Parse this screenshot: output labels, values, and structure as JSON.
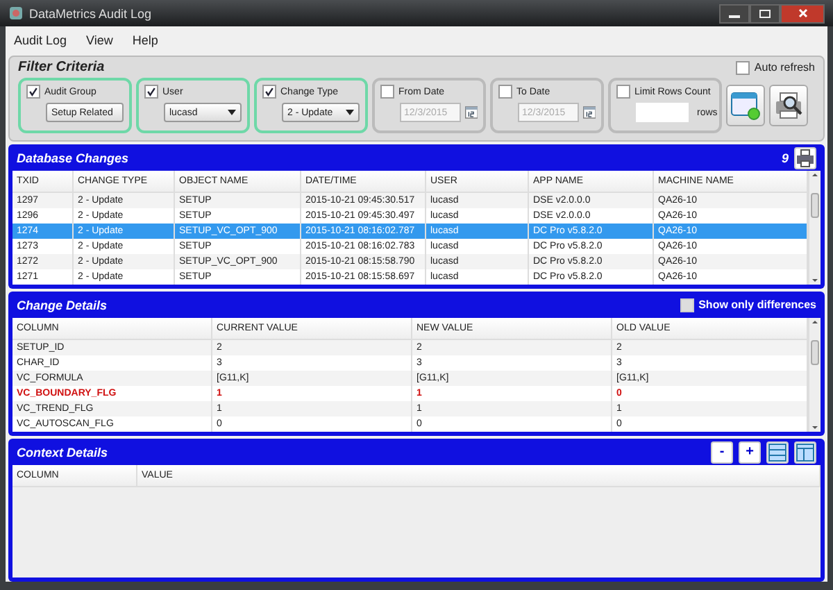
{
  "window": {
    "title": "DataMetrics Audit Log"
  },
  "menu": [
    "Audit Log",
    "View",
    "Help"
  ],
  "filter": {
    "title": "Filter Criteria",
    "auto_refresh": {
      "label": "Auto refresh",
      "checked": false
    },
    "groups": [
      {
        "kind": "dropdown",
        "label": "Audit Group",
        "checked": true,
        "value": "Setup Related"
      },
      {
        "kind": "dropdown",
        "label": "User",
        "checked": true,
        "value": "lucasd"
      },
      {
        "kind": "dropdown",
        "label": "Change Type",
        "checked": true,
        "value": "2 - Update"
      },
      {
        "kind": "date",
        "label": "From Date",
        "checked": false,
        "value": "12/3/2015"
      },
      {
        "kind": "date",
        "label": "To Date",
        "checked": false,
        "value": "12/3/2015"
      },
      {
        "kind": "count",
        "label": "Limit Rows Count",
        "checked": false,
        "unit": "rows"
      }
    ]
  },
  "database_changes": {
    "title": "Database Changes",
    "count": "9",
    "columns": [
      "TXID",
      "CHANGE TYPE",
      "OBJECT NAME",
      "DATE/TIME",
      "USER",
      "APP NAME",
      "MACHINE NAME"
    ],
    "rows": [
      {
        "selected": false,
        "cells": [
          "1297",
          "2 - Update",
          "SETUP",
          "2015-10-21 09:45:30.517",
          "lucasd",
          "DSE v2.0.0.0",
          "QA26-10"
        ]
      },
      {
        "selected": false,
        "cells": [
          "1296",
          "2 - Update",
          "SETUP",
          "2015-10-21 09:45:30.497",
          "lucasd",
          "DSE v2.0.0.0",
          "QA26-10"
        ]
      },
      {
        "selected": true,
        "cells": [
          "1274",
          "2 - Update",
          "SETUP_VC_OPT_900",
          "2015-10-21 08:16:02.787",
          "lucasd",
          "DC Pro v5.8.2.0",
          "QA26-10"
        ]
      },
      {
        "selected": false,
        "cells": [
          "1273",
          "2 - Update",
          "SETUP",
          "2015-10-21 08:16:02.783",
          "lucasd",
          "DC Pro v5.8.2.0",
          "QA26-10"
        ]
      },
      {
        "selected": false,
        "cells": [
          "1272",
          "2 - Update",
          "SETUP_VC_OPT_900",
          "2015-10-21 08:15:58.790",
          "lucasd",
          "DC Pro v5.8.2.0",
          "QA26-10"
        ]
      },
      {
        "selected": false,
        "cells": [
          "1271",
          "2 - Update",
          "SETUP",
          "2015-10-21 08:15:58.697",
          "lucasd",
          "DC Pro v5.8.2.0",
          "QA26-10"
        ]
      }
    ]
  },
  "change_details": {
    "title": "Change Details",
    "show_only_differences": {
      "label": "Show only differences",
      "checked": false
    },
    "columns": [
      "COLUMN",
      "CURRENT VALUE",
      "NEW VALUE",
      "OLD VALUE"
    ],
    "rows": [
      {
        "changed": false,
        "cells": [
          "SETUP_ID",
          "2",
          "2",
          "2"
        ]
      },
      {
        "changed": false,
        "cells": [
          "CHAR_ID",
          "3",
          "3",
          "3"
        ]
      },
      {
        "changed": false,
        "cells": [
          "VC_FORMULA",
          "[G11,K]",
          "[G11,K]",
          "[G11,K]"
        ]
      },
      {
        "changed": true,
        "cells": [
          "VC_BOUNDARY_FLG",
          "1",
          "1",
          "0"
        ]
      },
      {
        "changed": false,
        "cells": [
          "VC_TREND_FLG",
          "1",
          "1",
          "1"
        ]
      },
      {
        "changed": false,
        "cells": [
          "VC_AUTOSCAN_FLG",
          "0",
          "0",
          "0"
        ]
      }
    ]
  },
  "context_details": {
    "title": "Context Details",
    "buttons": [
      "-",
      "+"
    ],
    "columns": [
      "COLUMN",
      "VALUE"
    ]
  }
}
